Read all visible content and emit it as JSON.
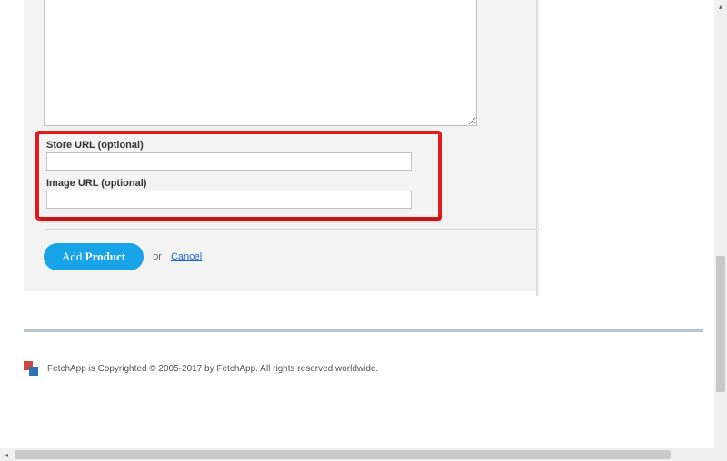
{
  "textarea": {
    "value": ""
  },
  "form": {
    "store_url": {
      "label": "Store URL (optional)",
      "value": ""
    },
    "image_url": {
      "label": "Image URL (optional)",
      "value": ""
    }
  },
  "actions": {
    "add_label_plain": "Add ",
    "add_label_bold": "Product",
    "or_text": "or",
    "cancel_label": "Cancel"
  },
  "footer": {
    "copyright": "FetchApp is Copyrighted © 2005-2017 by FetchApp. All rights reserved worldwide."
  }
}
